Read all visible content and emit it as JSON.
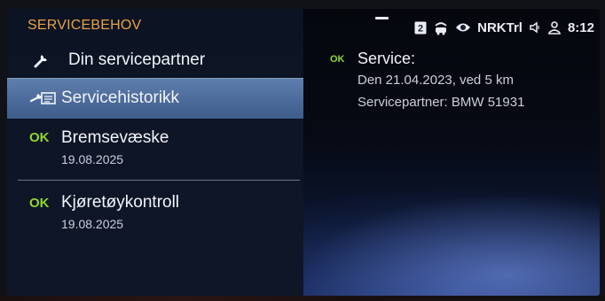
{
  "left_panel": {
    "title": "SERVICEBEHOV",
    "items": [
      {
        "label": "Din servicepartner",
        "icon": "wrench-icon"
      },
      {
        "label": "Servicehistorikk",
        "icon": "service-history-icon",
        "selected": true
      },
      {
        "status": "OK",
        "label": "Bremsevæske",
        "date": "19.08.2025"
      },
      {
        "status": "OK",
        "label": "Kjøretøykontroll",
        "date": "19.08.2025"
      }
    ]
  },
  "status_bar": {
    "channel_badge": "2",
    "radio_station": "NRKTrl",
    "time": "8:12"
  },
  "detail": {
    "status": "OK",
    "title": "Service:",
    "lines": [
      "Den 21.04.2023, ved 5 km",
      "Servicepartner: BMW 51931"
    ]
  },
  "colors": {
    "accent_orange": "#e8a24a",
    "ok_green": "#8fd630",
    "selection_blue": "#5174a4"
  }
}
